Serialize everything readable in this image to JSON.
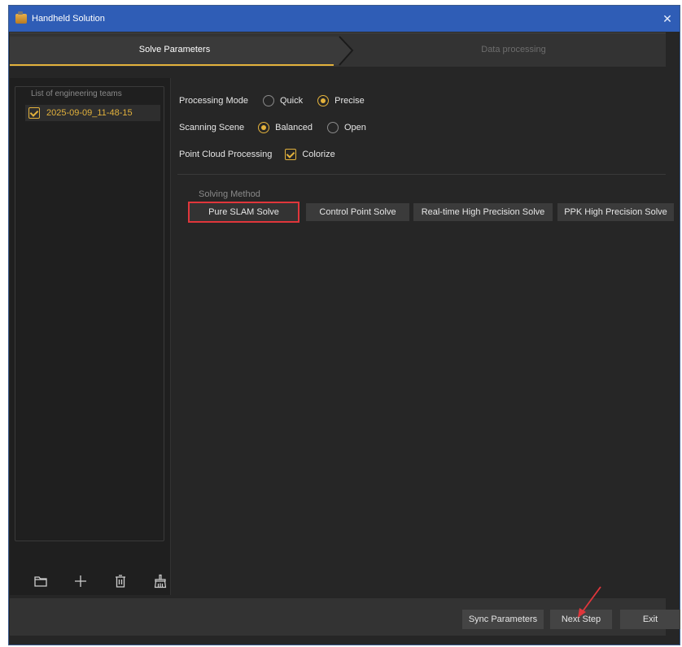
{
  "window": {
    "title": "Handheld Solution",
    "close": "✕"
  },
  "steps": [
    {
      "label": "Solve Parameters",
      "active": true
    },
    {
      "label": "Data processing",
      "active": false
    }
  ],
  "teams": {
    "legend": "List of engineering teams",
    "items": [
      {
        "name": "2025-09-09_11-48-15",
        "checked": true
      }
    ]
  },
  "toolbar_icons": [
    "folder-icon",
    "add-icon",
    "delete-icon",
    "clean-icon"
  ],
  "params": {
    "processing_mode": {
      "label": "Processing Mode",
      "options": [
        "Quick",
        "Precise"
      ],
      "selected": "Precise"
    },
    "scanning_scene": {
      "label": "Scanning Scene",
      "options": [
        "Balanced",
        "Open"
      ],
      "selected": "Balanced"
    },
    "point_cloud": {
      "label": "Point Cloud Processing",
      "colorize_label": "Colorize",
      "colorize": true
    }
  },
  "solving": {
    "title": "Solving Method",
    "buttons": [
      "Pure SLAM Solve",
      "Control Point Solve",
      "Real-time High Precision Solve",
      "PPK High Precision Solve"
    ],
    "selected": "Pure SLAM Solve"
  },
  "footer": {
    "sync": "Sync Parameters",
    "next": "Next Step",
    "exit": "Exit"
  },
  "colors": {
    "accent": "#e3b23c",
    "highlight": "#e0363b",
    "titlebar": "#2f5db6"
  }
}
